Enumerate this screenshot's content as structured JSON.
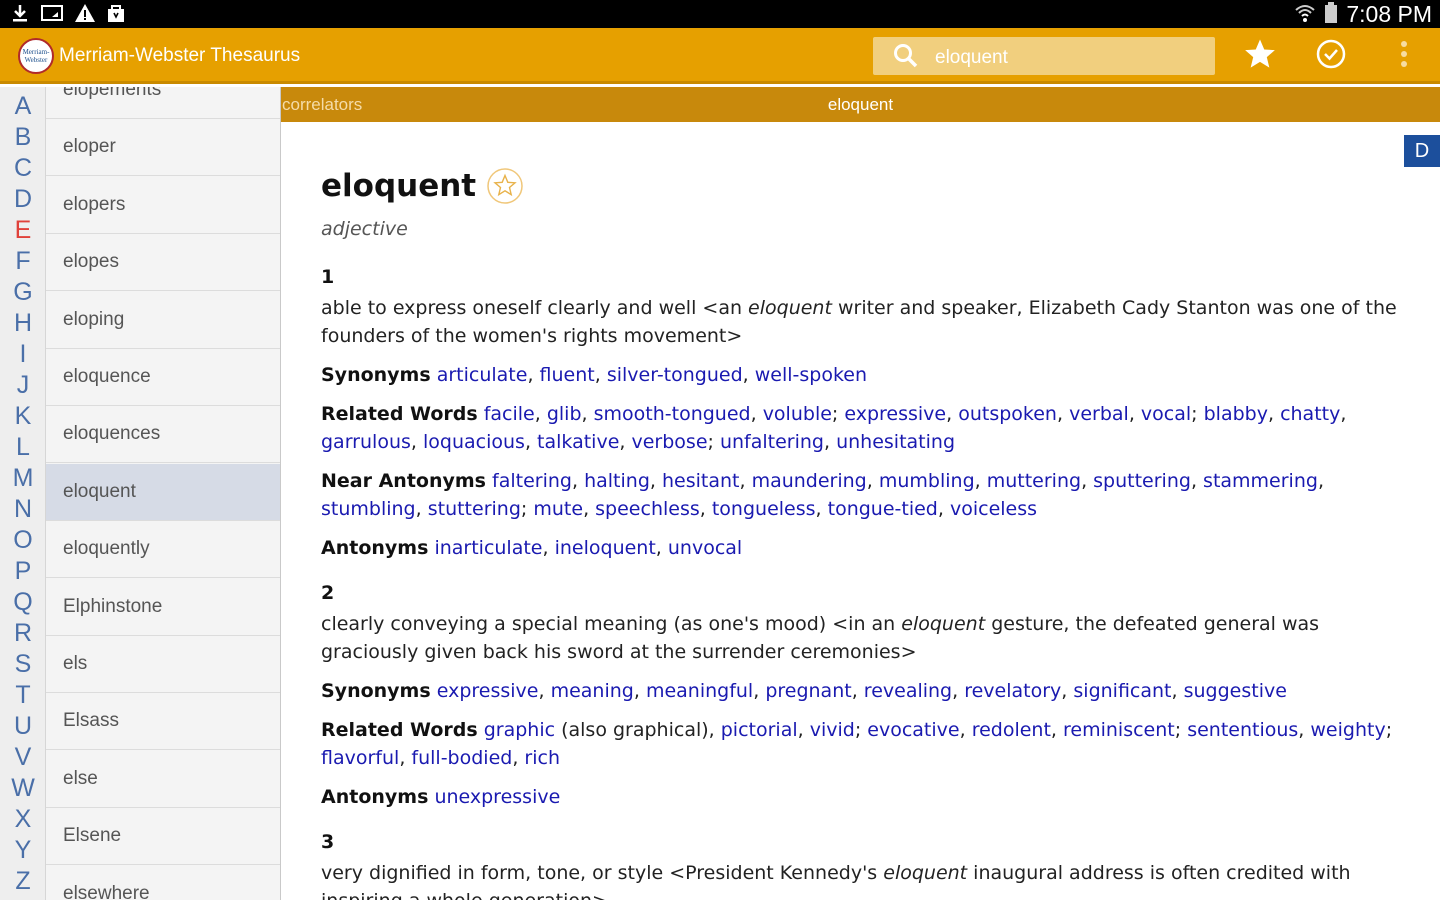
{
  "statusbar": {
    "time": "7:08 PM",
    "left_icons": [
      "download-icon",
      "cast-icon",
      "warning-icon",
      "bag-icon"
    ],
    "right_icons": [
      "wifi-icon",
      "battery-icon"
    ]
  },
  "appbar": {
    "logo_text": "Merriam-Webster",
    "title": "Merriam-Webster Thesaurus",
    "search_value": "eloquent",
    "actions": [
      "star-icon",
      "check-circle-icon",
      "overflow-menu-icon"
    ]
  },
  "subheader": {
    "crumb": "correlators",
    "title": "eloquent"
  },
  "alphabet": {
    "letters": [
      "A",
      "B",
      "C",
      "D",
      "E",
      "F",
      "G",
      "H",
      "I",
      "J",
      "K",
      "L",
      "M",
      "N",
      "O",
      "P",
      "Q",
      "R",
      "S",
      "T",
      "U",
      "V",
      "W",
      "X",
      "Y",
      "Z"
    ],
    "active": "E"
  },
  "wordlist": {
    "items": [
      "elopements",
      "eloper",
      "elopers",
      "elopes",
      "eloping",
      "eloquence",
      "eloquences",
      "eloquent",
      "eloquently",
      "Elphinstone",
      "els",
      "Elsass",
      "else",
      "Elsene",
      "elsewhere"
    ],
    "selected": "eloquent"
  },
  "entry": {
    "side_tab": "D",
    "headword": "eloquent",
    "pos": "adjective",
    "senses": [
      {
        "num": "1",
        "def": [
          {
            "t": "able to express oneself clearly and well <an "
          },
          {
            "t": "eloquent",
            "i": true
          },
          {
            "t": " writer and speaker, Elizabeth Cady Stanton was one of the founders of the women's rights movement>"
          }
        ],
        "groups": [
          {
            "label": "Synonyms",
            "parts": [
              {
                "t": "articulate",
                "l": true
              },
              {
                "t": ", "
              },
              {
                "t": "fluent",
                "l": true
              },
              {
                "t": ", "
              },
              {
                "t": "silver-tongued",
                "l": true
              },
              {
                "t": ", "
              },
              {
                "t": "well-spoken",
                "l": true
              }
            ]
          },
          {
            "label": "Related Words",
            "parts": [
              {
                "t": "facile",
                "l": true
              },
              {
                "t": ", "
              },
              {
                "t": "glib",
                "l": true
              },
              {
                "t": ", "
              },
              {
                "t": "smooth-tongued",
                "l": true
              },
              {
                "t": ", "
              },
              {
                "t": "voluble",
                "l": true
              },
              {
                "t": "; "
              },
              {
                "t": "expressive",
                "l": true
              },
              {
                "t": ", "
              },
              {
                "t": "outspoken",
                "l": true
              },
              {
                "t": ", "
              },
              {
                "t": "verbal",
                "l": true
              },
              {
                "t": ", "
              },
              {
                "t": "vocal",
                "l": true
              },
              {
                "t": "; "
              },
              {
                "t": "blabby",
                "l": true
              },
              {
                "t": ", "
              },
              {
                "t": "chatty",
                "l": true
              },
              {
                "t": ", "
              },
              {
                "t": "garrulous",
                "l": true
              },
              {
                "t": ", "
              },
              {
                "t": "loquacious",
                "l": true
              },
              {
                "t": ", "
              },
              {
                "t": "talkative",
                "l": true
              },
              {
                "t": ", "
              },
              {
                "t": "verbose",
                "l": true
              },
              {
                "t": "; "
              },
              {
                "t": "unfaltering",
                "l": true
              },
              {
                "t": ", "
              },
              {
                "t": "unhesitating",
                "l": true
              }
            ]
          },
          {
            "label": "Near Antonyms",
            "parts": [
              {
                "t": "faltering",
                "l": true
              },
              {
                "t": ", "
              },
              {
                "t": "halting",
                "l": true
              },
              {
                "t": ", "
              },
              {
                "t": "hesitant",
                "l": true
              },
              {
                "t": ", "
              },
              {
                "t": "maundering",
                "l": true
              },
              {
                "t": ", "
              },
              {
                "t": "mumbling",
                "l": true
              },
              {
                "t": ", "
              },
              {
                "t": "muttering",
                "l": true
              },
              {
                "t": ", "
              },
              {
                "t": "sputtering",
                "l": true
              },
              {
                "t": ", "
              },
              {
                "t": "stammering",
                "l": true
              },
              {
                "t": ", "
              },
              {
                "t": "stumbling",
                "l": true
              },
              {
                "t": ", "
              },
              {
                "t": "stuttering",
                "l": true
              },
              {
                "t": "; "
              },
              {
                "t": "mute",
                "l": true
              },
              {
                "t": ", "
              },
              {
                "t": "speechless",
                "l": true
              },
              {
                "t": ", "
              },
              {
                "t": "tongueless",
                "l": true
              },
              {
                "t": ", "
              },
              {
                "t": "tongue-tied",
                "l": true
              },
              {
                "t": ", "
              },
              {
                "t": "voiceless",
                "l": true
              }
            ]
          },
          {
            "label": "Antonyms",
            "parts": [
              {
                "t": "inarticulate",
                "l": true
              },
              {
                "t": ", "
              },
              {
                "t": "ineloquent",
                "l": true
              },
              {
                "t": ", "
              },
              {
                "t": "unvocal",
                "l": true
              }
            ]
          }
        ]
      },
      {
        "num": "2",
        "def": [
          {
            "t": "clearly conveying a special meaning (as one's mood) <in an "
          },
          {
            "t": "eloquent",
            "i": true
          },
          {
            "t": " gesture, the defeated general was graciously given back his sword at the surrender ceremonies>"
          }
        ],
        "groups": [
          {
            "label": "Synonyms",
            "parts": [
              {
                "t": "expressive",
                "l": true
              },
              {
                "t": ", "
              },
              {
                "t": "meaning",
                "l": true
              },
              {
                "t": ", "
              },
              {
                "t": "meaningful",
                "l": true
              },
              {
                "t": ", "
              },
              {
                "t": "pregnant",
                "l": true
              },
              {
                "t": ", "
              },
              {
                "t": "revealing",
                "l": true
              },
              {
                "t": ", "
              },
              {
                "t": "revelatory",
                "l": true
              },
              {
                "t": ", "
              },
              {
                "t": "significant",
                "l": true
              },
              {
                "t": ", "
              },
              {
                "t": "suggestive",
                "l": true
              }
            ]
          },
          {
            "label": "Related Words",
            "parts": [
              {
                "t": "graphic",
                "l": true
              },
              {
                "t": " (also graphical), "
              },
              {
                "t": "pictorial",
                "l": true
              },
              {
                "t": ", "
              },
              {
                "t": "vivid",
                "l": true
              },
              {
                "t": "; "
              },
              {
                "t": "evocative",
                "l": true
              },
              {
                "t": ", "
              },
              {
                "t": "redolent",
                "l": true
              },
              {
                "t": ", "
              },
              {
                "t": "reminiscent",
                "l": true
              },
              {
                "t": "; "
              },
              {
                "t": "sententious",
                "l": true
              },
              {
                "t": ", "
              },
              {
                "t": "weighty",
                "l": true
              },
              {
                "t": "; "
              },
              {
                "t": "flavorful",
                "l": true
              },
              {
                "t": ", "
              },
              {
                "t": "full-bodied",
                "l": true
              },
              {
                "t": ", "
              },
              {
                "t": "rich",
                "l": true
              }
            ]
          },
          {
            "label": "Antonyms",
            "parts": [
              {
                "t": "unexpressive",
                "l": true
              }
            ]
          }
        ]
      },
      {
        "num": "3",
        "def": [
          {
            "t": "very dignified in form, tone, or style <President Kennedy's "
          },
          {
            "t": "eloquent",
            "i": true
          },
          {
            "t": " inaugural address is often credited with inspiring a whole generation>"
          }
        ],
        "groups": []
      }
    ]
  },
  "colors": {
    "appbar": "#e6a000",
    "subheader": "#c8890c",
    "link": "#1a1ab0",
    "active_letter": "#e0413a",
    "side_tab": "#1c4f9c"
  }
}
